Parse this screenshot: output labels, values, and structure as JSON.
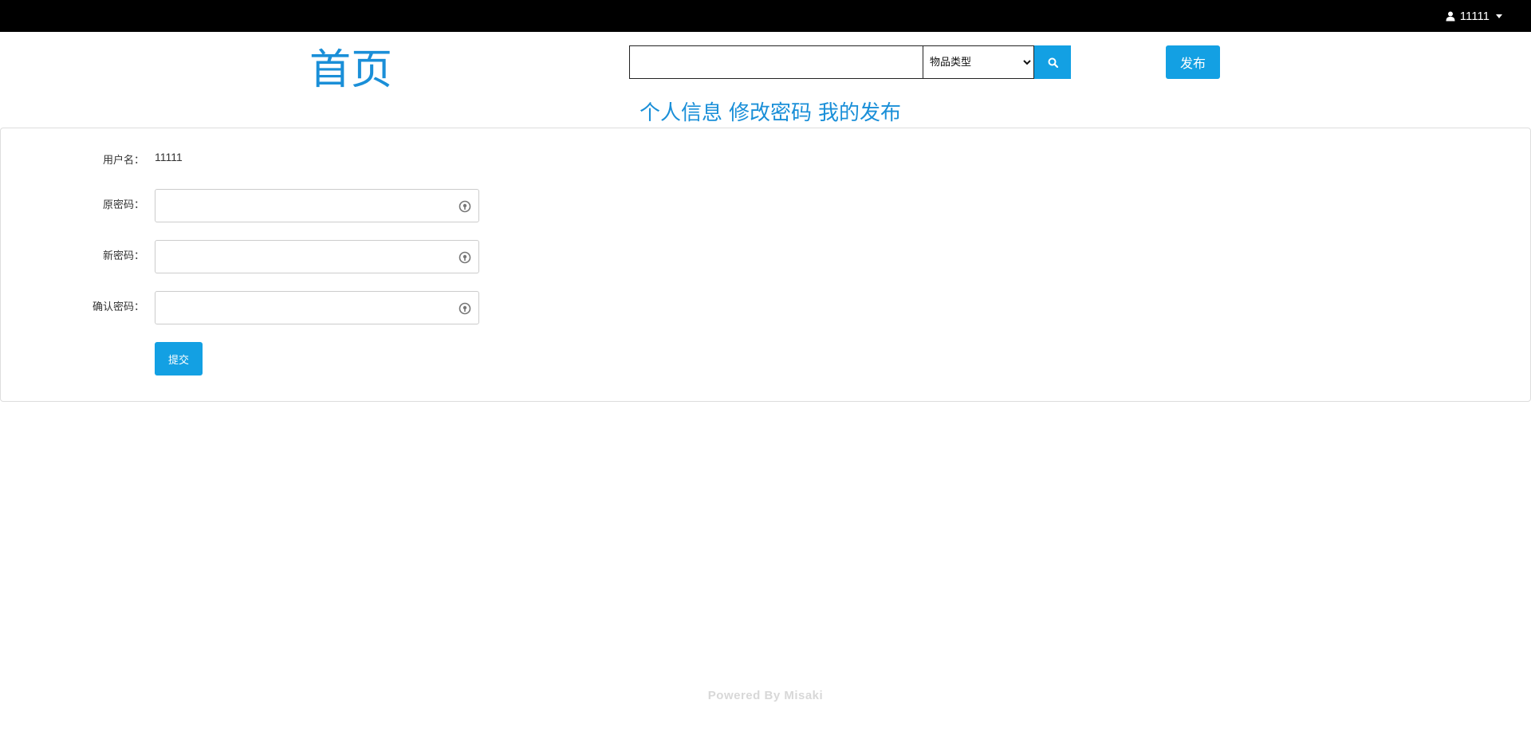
{
  "topbar": {
    "username": "11111",
    "user_icon": "user-icon",
    "caret_icon": "caret-down-icon"
  },
  "header": {
    "home_label": "首页",
    "search": {
      "value": "",
      "placeholder": ""
    },
    "type_select": {
      "selected": "物品类型"
    },
    "search_icon": "search-icon",
    "publish_label": "发布"
  },
  "subnav": {
    "items": [
      {
        "label": "个人信息"
      },
      {
        "label": "修改密码"
      },
      {
        "label": "我的发布"
      }
    ]
  },
  "form": {
    "username_label": "用户名：",
    "username_value": "11111",
    "old_password_label": "原密码：",
    "new_password_label": "新密码：",
    "confirm_password_label": "确认密码：",
    "reveal_icon": "eye-reveal-icon",
    "submit_label": "提交"
  },
  "footer": {
    "text": "Powered By Misaki"
  },
  "colors": {
    "topbar": "#000000",
    "accent": "#13a0e3",
    "link": "#1a8fd8",
    "footer_text": "#d8d8d8"
  }
}
